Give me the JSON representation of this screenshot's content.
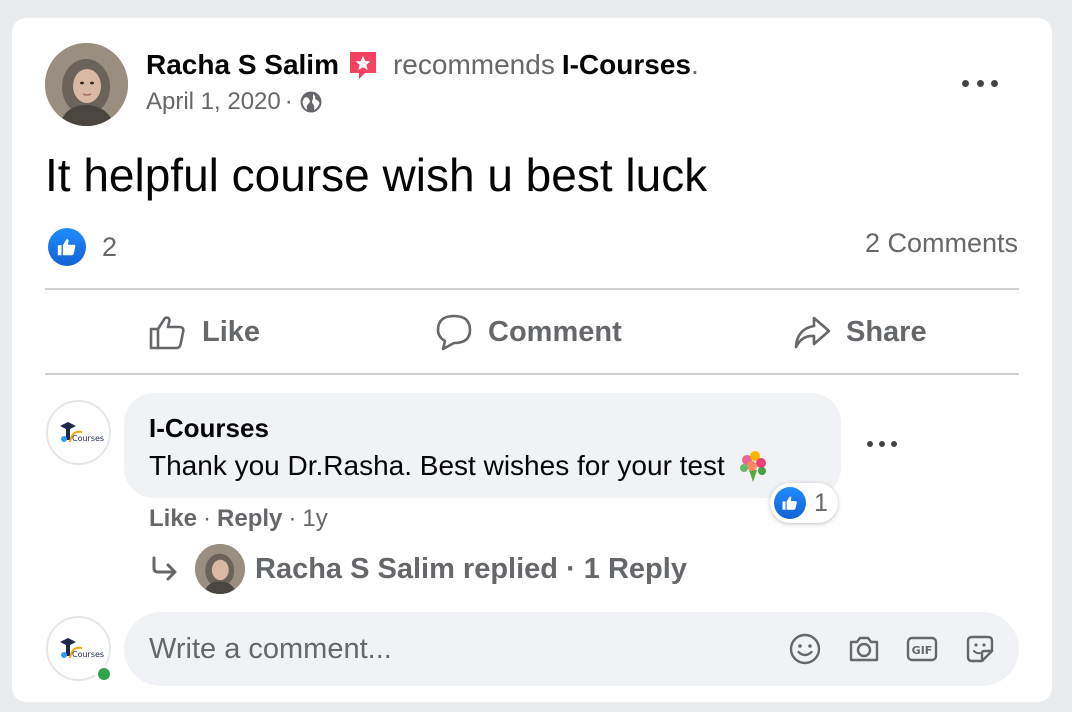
{
  "post": {
    "author": "Racha S Salim",
    "recommends_text": "recommends",
    "page_name": "I-Courses",
    "page_name_suffix": ".",
    "date": "April 1, 2020",
    "date_separator": "·",
    "text": "It helpful course wish u best luck",
    "reaction_count": "2",
    "comments_count": "2 Comments"
  },
  "actions": {
    "like": "Like",
    "comment": "Comment",
    "share": "Share"
  },
  "comment": {
    "author": "I-Courses",
    "text": "Thank you Dr.Rasha. Best wishes for your test",
    "reaction_count": "1",
    "like": "Like",
    "reply": "Reply",
    "separator": "·",
    "time": "1y",
    "reply_summary": "Racha S Salim replied · 1 Reply"
  },
  "composer": {
    "placeholder": "Write a comment..."
  },
  "icons": {
    "recommend_badge": "recommend-star-icon",
    "audience": "globe-icon",
    "like": "thumbs-up-icon",
    "comment": "speech-bubble-icon",
    "share": "share-arrow-icon",
    "reply": "reply-arrow-icon",
    "emoji": "smiley-icon",
    "camera": "camera-icon",
    "gif": "gif-icon",
    "sticker": "sticker-icon"
  },
  "colors": {
    "like_blue": "#1877f2",
    "recommend_red": "#f3425f",
    "online_green": "#31a24c",
    "secondary_text": "#65676b"
  }
}
